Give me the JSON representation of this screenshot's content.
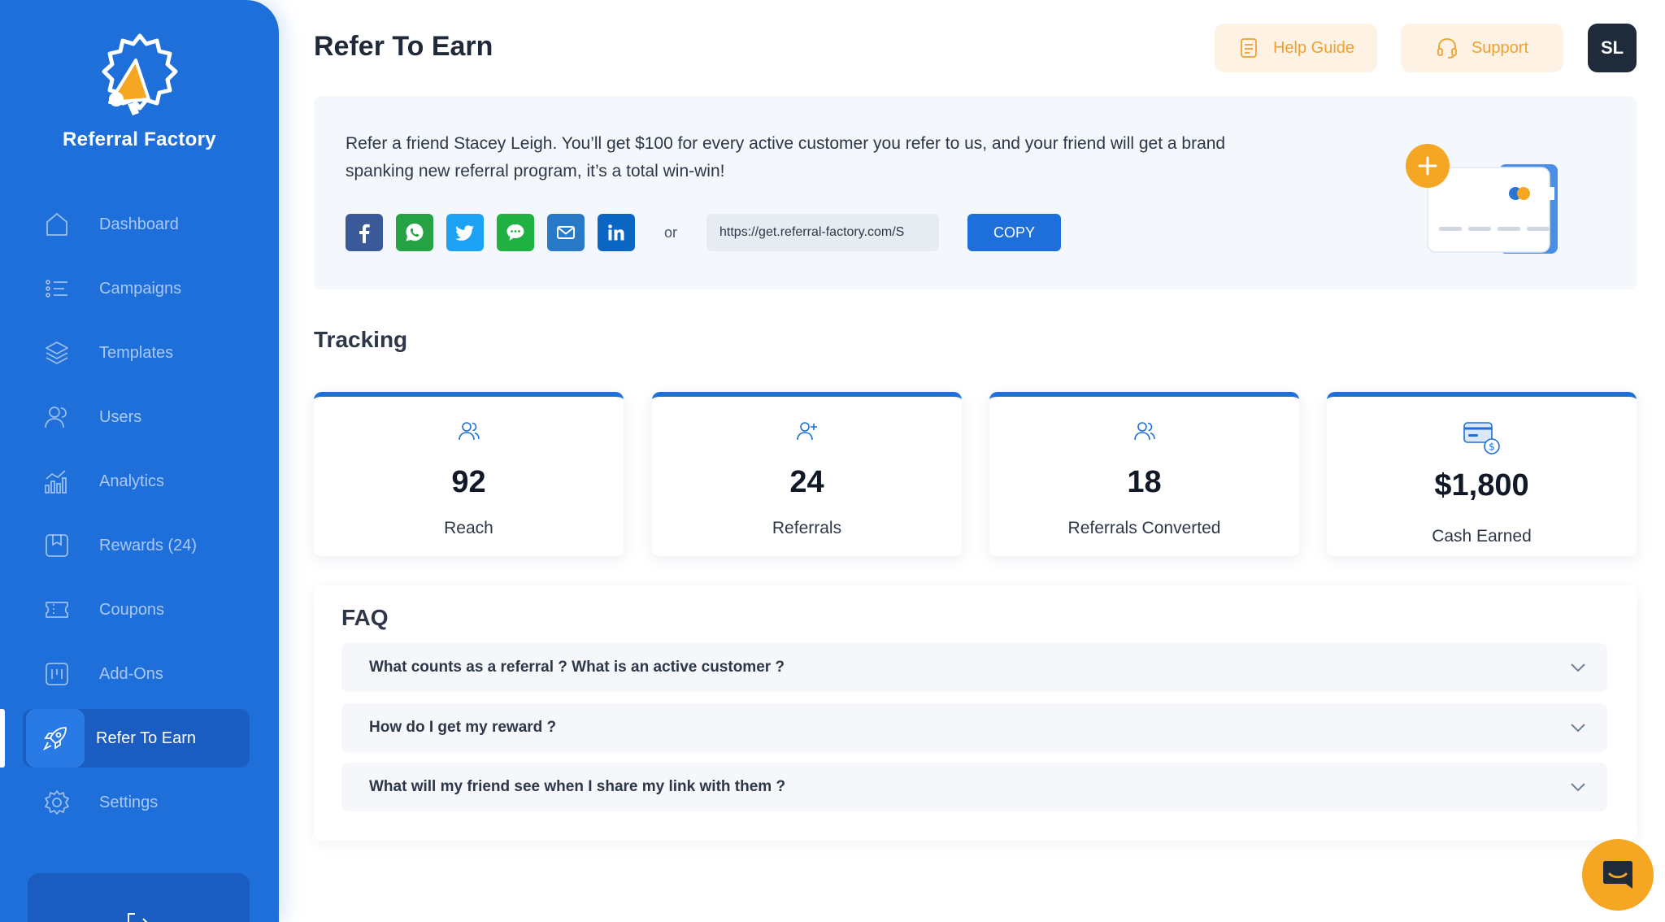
{
  "brand": {
    "name": "Referral Factory"
  },
  "nav": {
    "items": [
      {
        "label": "Dashboard"
      },
      {
        "label": "Campaigns"
      },
      {
        "label": "Templates"
      },
      {
        "label": "Users"
      },
      {
        "label": "Analytics"
      },
      {
        "label": "Rewards (24)"
      },
      {
        "label": "Coupons"
      },
      {
        "label": "Add-Ons"
      },
      {
        "label": "Refer To Earn",
        "active": true
      },
      {
        "label": "Settings"
      }
    ]
  },
  "header": {
    "title": "Refer To Earn",
    "help_label": "Help Guide",
    "support_label": "Support",
    "avatar_initials": "SL"
  },
  "refer": {
    "message": "Refer a friend Stacey Leigh. You’ll get $100 for every active customer you refer to us, and your friend will get a brand spanking new referral program, it’s a total win-win!",
    "or_label": "or",
    "link_value": "https://get.referral-factory.com/S",
    "copy_label": "COPY"
  },
  "tracking": {
    "title": "Tracking",
    "stats": [
      {
        "value": "92",
        "label": "Reach"
      },
      {
        "value": "24",
        "label": "Referrals"
      },
      {
        "value": "18",
        "label": "Referrals Converted"
      },
      {
        "value": "$1,800",
        "label": "Cash Earned"
      }
    ]
  },
  "faq": {
    "title": "FAQ",
    "items": [
      {
        "question": "What counts as a referral ? What is an active customer ?"
      },
      {
        "question": "How do I get my reward ?"
      },
      {
        "question": "What will my friend see when I share my link with them ?"
      }
    ]
  },
  "colors": {
    "primary": "#1e6fd9",
    "accent": "#f5a623",
    "facebook": "#3b5998",
    "whatsapp": "#25a244",
    "twitter": "#1da1f2",
    "sms": "#1fb141",
    "email": "#2979c9",
    "linkedin": "#0a66c2"
  }
}
